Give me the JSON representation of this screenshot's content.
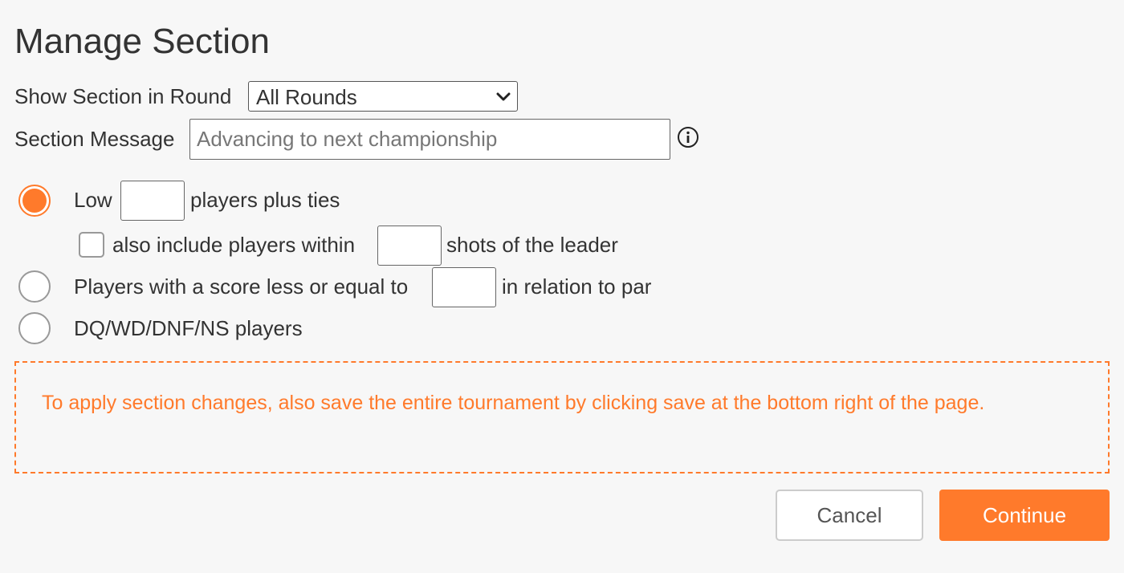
{
  "page": {
    "title": "Manage Section"
  },
  "round": {
    "label": "Show Section in Round",
    "selected": "All Rounds"
  },
  "message": {
    "label": "Section Message",
    "placeholder": "Advancing to next championship",
    "value": ""
  },
  "options": {
    "low": {
      "prefix": "Low",
      "suffix": "players plus ties",
      "selected": true,
      "value": ""
    },
    "within": {
      "label": "also include players within",
      "suffix": "shots of the leader",
      "checked": false,
      "value": ""
    },
    "score": {
      "label": "Players with a score less or equal to",
      "suffix": "in relation to par",
      "selected": false,
      "value": ""
    },
    "dq": {
      "label": "DQ/WD/DNF/NS players",
      "selected": false
    }
  },
  "notice": {
    "text": "To apply section changes, also save the entire tournament by clicking save at the bottom right of the page."
  },
  "buttons": {
    "cancel": "Cancel",
    "continue": "Continue"
  },
  "icons": {
    "chevron": "chevron-down-icon",
    "info": "info-icon"
  },
  "colors": {
    "accent": "#ff7a2b",
    "text": "#333333",
    "background": "#f7f7f7"
  }
}
